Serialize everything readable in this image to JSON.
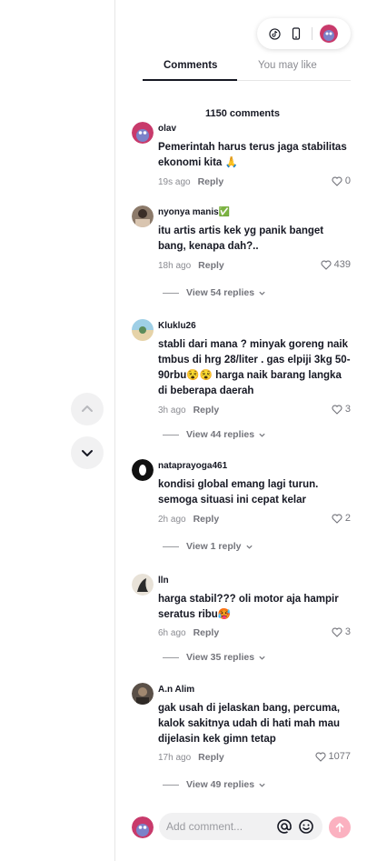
{
  "top_controls": {
    "icons": [
      "tiktok-icon",
      "phone-icon",
      "profile-avatar"
    ]
  },
  "tabs": {
    "comments": "Comments",
    "you_may_like": "You may like"
  },
  "comment_count": "1150 comments",
  "reply_label": "Reply",
  "comments": [
    {
      "username": "olav",
      "text": "Pemerintah harus terus jaga stabilitas ekonomi kita 🙏",
      "time": "19s ago",
      "likes": "0",
      "view_replies": ""
    },
    {
      "username": "nyonya manis✅",
      "text": "itu artis artis kek yg panik banget bang, kenapa dah?..",
      "time": "18h ago",
      "likes": "439",
      "view_replies": "View 54 replies"
    },
    {
      "username": "Kluklu26",
      "text": "stabli dari mana ? minyak goreng naik tmbus di hrg 28/liter . gas elpiji 3kg 50-90rbu😵😵 harga naik barang langka di beberapa daerah",
      "time": "3h ago",
      "likes": "3",
      "view_replies": "View 44 replies"
    },
    {
      "username": "nataprayoga461",
      "text": "kondisi global emang lagi turun. semoga situasi ini cepat kelar",
      "time": "2h ago",
      "likes": "2",
      "view_replies": "View 1 reply"
    },
    {
      "username": "lln",
      "text": "harga stabil??? oli motor aja hampir seratus ribu🥵",
      "time": "6h ago",
      "likes": "3",
      "view_replies": "View 35 replies"
    },
    {
      "username": "A.n Alim",
      "text": "gak usah di jelaskan bang, percuma, kalok sakitnya udah di hati mah mau dijelasin kek gimn tetap",
      "time": "17h ago",
      "likes": "1077",
      "view_replies": "View 49 replies"
    }
  ],
  "composer": {
    "placeholder": "Add comment..."
  }
}
